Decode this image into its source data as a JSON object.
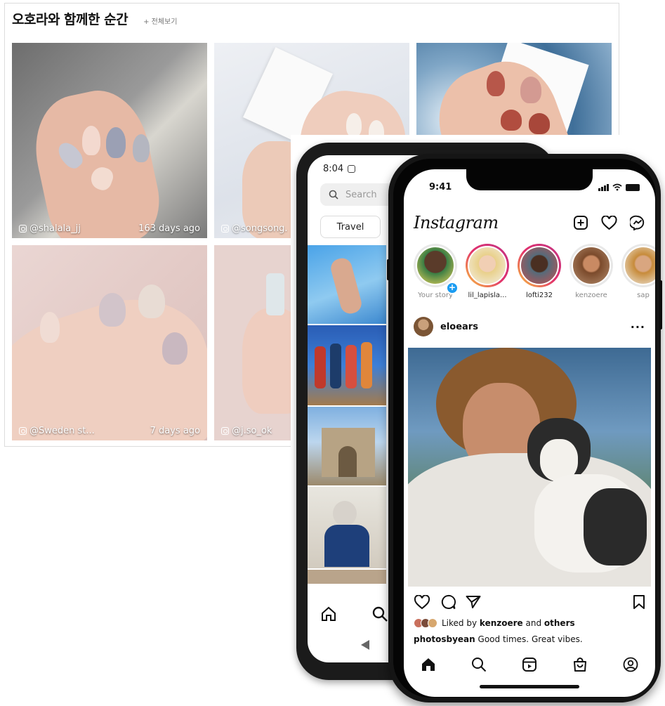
{
  "gallery": {
    "title": "오호라와 함께한 순간",
    "view_all": "+ 전체보기",
    "tiles": [
      {
        "handle": "@shalala_jj",
        "age": "163 days ago"
      },
      {
        "handle": "@songsong.",
        "age": ""
      },
      {
        "handle": "",
        "age": ""
      },
      {
        "handle": "@Sweden st...",
        "age": "7 days ago"
      },
      {
        "handle": "@j.so_ok",
        "age": ""
      }
    ]
  },
  "back_phone": {
    "time": "8:04",
    "search_placeholder": "Search",
    "chip": "Travel"
  },
  "front_phone": {
    "time": "9:41",
    "app_name": "Instagram",
    "stories": [
      {
        "label": "Your story"
      },
      {
        "label": "lil_lapisla..."
      },
      {
        "label": "lofti232"
      },
      {
        "label": "kenzoere"
      },
      {
        "label": "sap"
      }
    ],
    "post": {
      "user": "eloears",
      "more": "···",
      "liked_prefix": "Liked by",
      "liked_user": "kenzoere",
      "liked_and": "and",
      "liked_others": "others",
      "caption_user": "photosbyean",
      "caption_text": "Good times. Great vibes."
    }
  },
  "colors": {
    "story_ring_start": "#f9c63d",
    "story_ring_end": "#c13584",
    "badge_blue": "#1b9cf2"
  }
}
